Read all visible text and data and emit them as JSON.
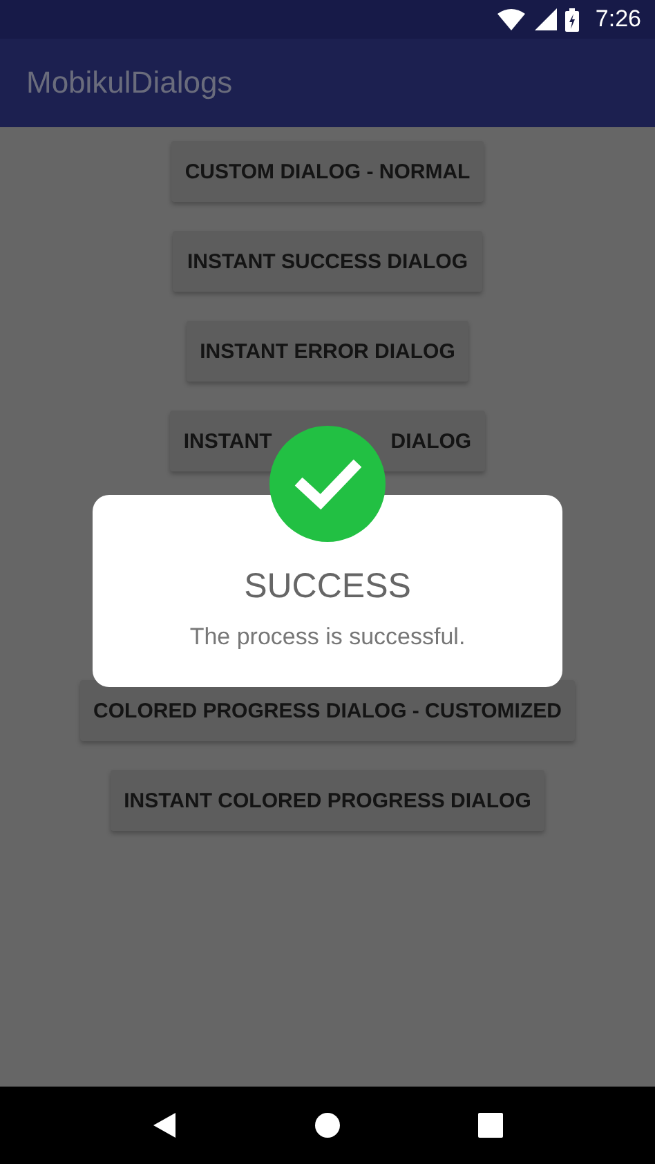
{
  "status_bar": {
    "time": "7:26"
  },
  "app_bar": {
    "title": "MobikulDialogs"
  },
  "buttons_above": [
    "CUSTOM DIALOG - NORMAL",
    "INSTANT SUCCESS DIALOG",
    "INSTANT ERROR DIALOG",
    [
      "INSTANT",
      "DIALOG"
    ]
  ],
  "buttons_below": [
    "COLORED PROGRESS DIALOG - CUSTOMIZED",
    "INSTANT COLORED PROGRESS DIALOG"
  ],
  "dialog": {
    "kind": "success",
    "title": "SUCCESS",
    "message": "The process is successful."
  }
}
